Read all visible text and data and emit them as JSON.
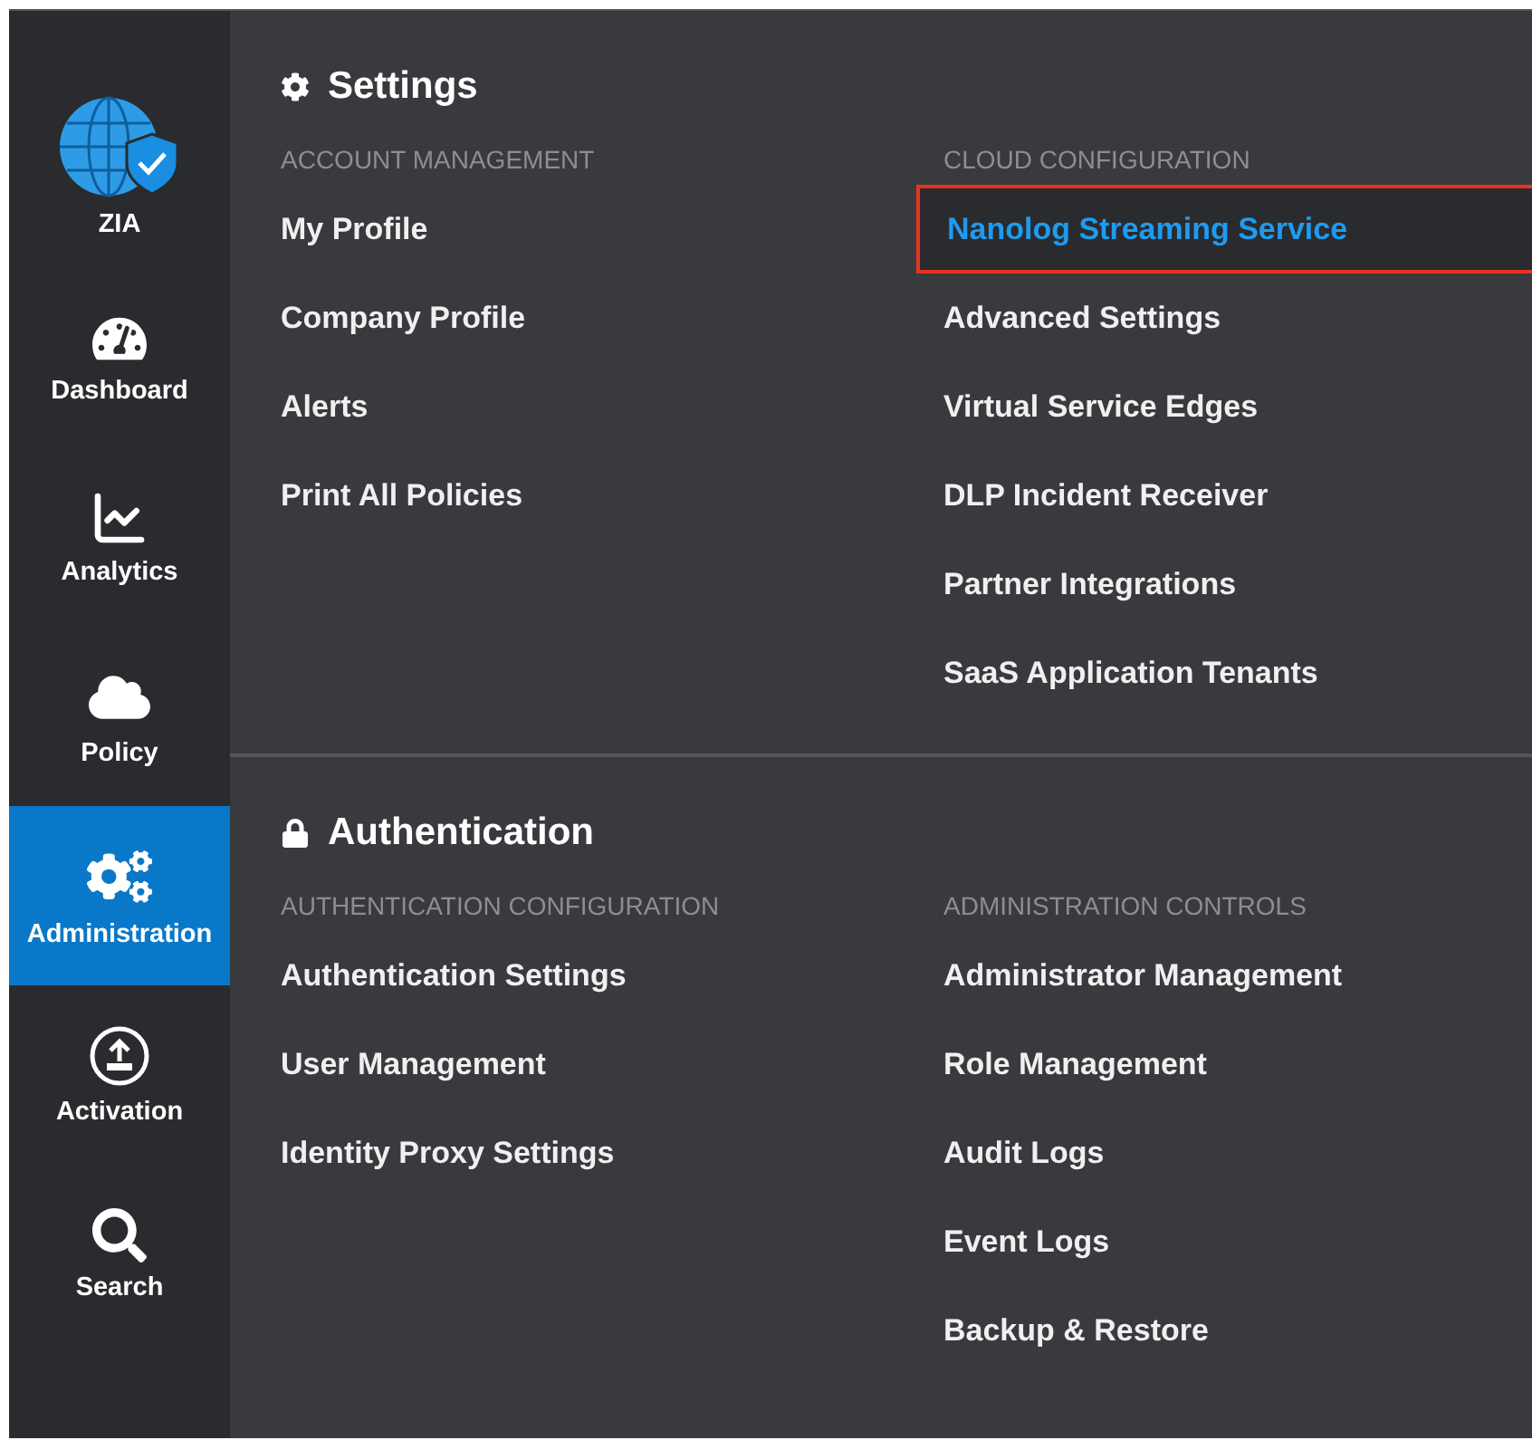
{
  "sidebar": {
    "items": [
      {
        "label": "ZIA",
        "selected": false
      },
      {
        "label": "Dashboard",
        "selected": false
      },
      {
        "label": "Analytics",
        "selected": false
      },
      {
        "label": "Policy",
        "selected": false
      },
      {
        "label": "Administration",
        "selected": true
      },
      {
        "label": "Activation",
        "selected": false
      },
      {
        "label": "Search",
        "selected": false
      }
    ]
  },
  "sections": [
    {
      "title": "Settings",
      "groups": [
        {
          "heading": "ACCOUNT MANAGEMENT",
          "items": [
            {
              "label": "My Profile",
              "selected": false
            },
            {
              "label": "Company Profile",
              "selected": false
            },
            {
              "label": "Alerts",
              "selected": false
            },
            {
              "label": "Print All Policies",
              "selected": false
            }
          ]
        },
        {
          "heading": "CLOUD CONFIGURATION",
          "items": [
            {
              "label": "Nanolog Streaming Service",
              "selected": true
            },
            {
              "label": "Advanced Settings",
              "selected": false
            },
            {
              "label": "Virtual Service Edges",
              "selected": false
            },
            {
              "label": "DLP Incident Receiver",
              "selected": false
            },
            {
              "label": "Partner Integrations",
              "selected": false
            },
            {
              "label": "SaaS Application Tenants",
              "selected": false
            }
          ]
        }
      ]
    },
    {
      "title": "Authentication",
      "groups": [
        {
          "heading": "AUTHENTICATION CONFIGURATION",
          "items": [
            {
              "label": "Authentication Settings",
              "selected": false
            },
            {
              "label": "User Management",
              "selected": false
            },
            {
              "label": "Identity Proxy Settings",
              "selected": false
            }
          ]
        },
        {
          "heading": "ADMINISTRATION CONTROLS",
          "items": [
            {
              "label": "Administrator Management",
              "selected": false
            },
            {
              "label": "Role Management",
              "selected": false
            },
            {
              "label": "Audit Logs",
              "selected": false
            },
            {
              "label": "Event Logs",
              "selected": false
            },
            {
              "label": "Backup & Restore",
              "selected": false
            }
          ]
        }
      ]
    }
  ]
}
